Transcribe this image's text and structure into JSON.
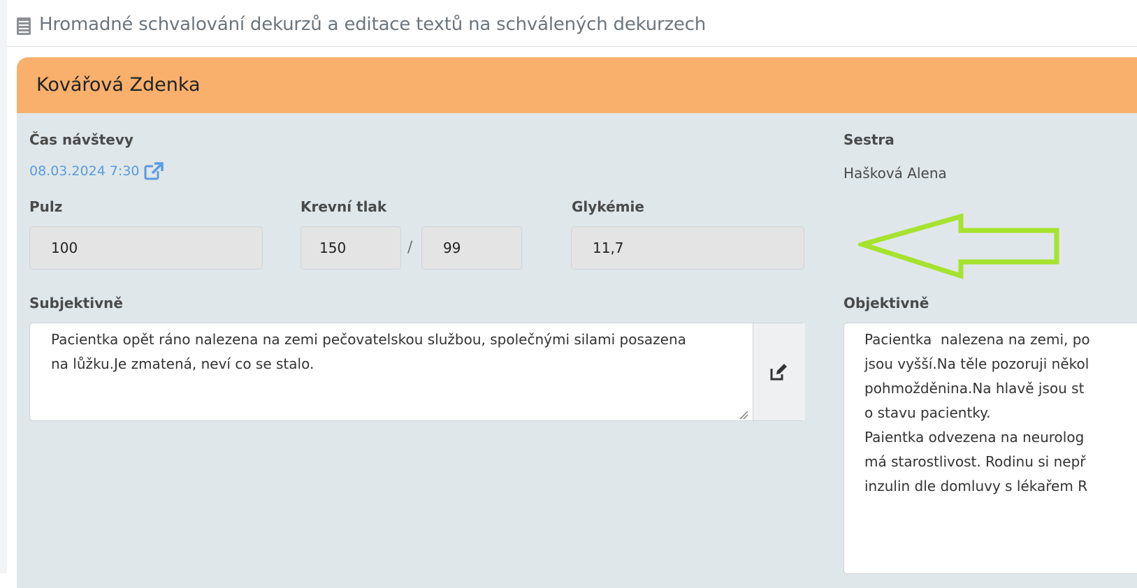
{
  "header": {
    "title": "Hromadné schvalování dekurzů a editace textů na schválených dekurzech",
    "icon": "document-list-icon"
  },
  "card": {
    "patient_name": "Kovářová Zdenka",
    "header_color": "#f8b06c",
    "visit_time": {
      "label": "Čas návštevy",
      "value": "08.03.2024 7:30",
      "link_color": "#5a9be0",
      "icon": "external-link-icon"
    },
    "nurse": {
      "label": "Sestra",
      "value": "Hašková Alena"
    },
    "pulse": {
      "label": "Pulz",
      "value": "100"
    },
    "blood_pressure": {
      "label": "Krevní tlak",
      "systolic": "150",
      "separator": "/",
      "diastolic": "99"
    },
    "glycemia": {
      "label": "Glykémie",
      "value": "11,7"
    },
    "subjective": {
      "label": "Subjektivně",
      "lines": [
        "Pacientka opět ráno nalezena na zemi pečovatelskou službou, společnými silami posazena",
        "na lůžku.Je zmatená, neví co se stalo."
      ],
      "edit_icon": "edit-icon"
    },
    "objective": {
      "label": "Objektivně",
      "lines": [
        "Pacientka  nalezena na zemi, po",
        "jsou vyšší.Na těle pozoruji někol",
        "pohmožděnina.Na hlavě jsou st",
        "o stavu pacientky.",
        "Paientka odvezena na neurolog",
        "má starostlivost. Rodinu si nepř",
        "inzulin dle domluvy s lékařem R"
      ]
    }
  },
  "annotation": {
    "type": "arrow-left",
    "color": "#a6e22e"
  }
}
